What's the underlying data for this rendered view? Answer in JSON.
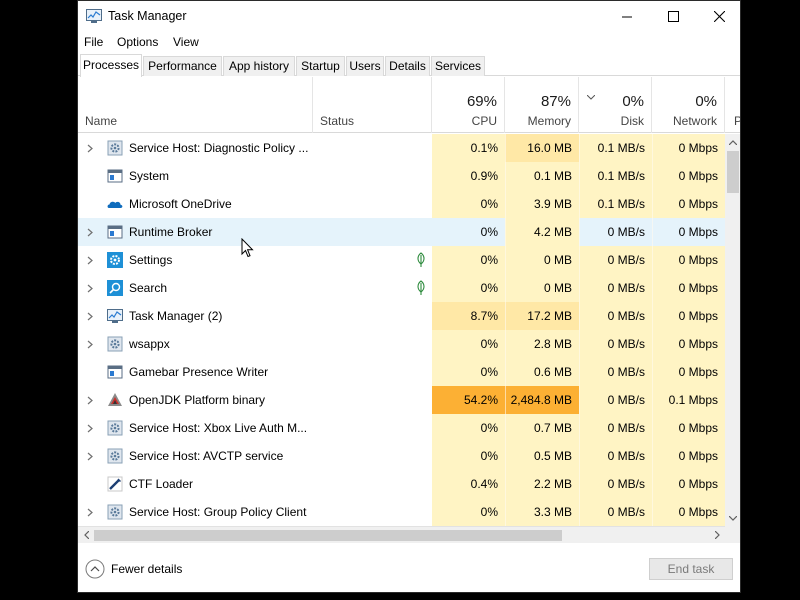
{
  "window": {
    "title": "Task Manager"
  },
  "menu": [
    "File",
    "Options",
    "View"
  ],
  "tabs": [
    "Processes",
    "Performance",
    "App history",
    "Startup",
    "Users",
    "Details",
    "Services"
  ],
  "active_tab": "Processes",
  "columns": {
    "name": "Name",
    "status": "Status",
    "cpu": {
      "pct": "69%",
      "label": "CPU"
    },
    "memory": {
      "pct": "87%",
      "label": "Memory"
    },
    "disk": {
      "pct": "0%",
      "label": "Disk"
    },
    "network": {
      "pct": "0%",
      "label": "Network"
    },
    "power": {
      "label": "P"
    }
  },
  "processes": [
    {
      "name": "Service Host: Diagnostic Policy ...",
      "icon": "gear-icon",
      "expandable": true,
      "status": "",
      "cpu": "0.1%",
      "memory": "16.0 MB",
      "disk": "0.1 MB/s",
      "network": "0 Mbps"
    },
    {
      "name": "System",
      "icon": "window-icon",
      "expandable": false,
      "status": "",
      "cpu": "0.9%",
      "memory": "0.1 MB",
      "disk": "0.1 MB/s",
      "network": "0 Mbps"
    },
    {
      "name": "Microsoft OneDrive",
      "icon": "cloud-icon",
      "expandable": false,
      "status": "",
      "cpu": "0%",
      "memory": "3.9 MB",
      "disk": "0.1 MB/s",
      "network": "0 Mbps"
    },
    {
      "name": "Runtime Broker",
      "icon": "window-icon",
      "expandable": true,
      "status": "",
      "cpu": "0%",
      "memory": "4.2 MB",
      "disk": "0 MB/s",
      "network": "0 Mbps"
    },
    {
      "name": "Settings",
      "icon": "settings-gear-icon",
      "expandable": true,
      "status": "suspended-leaf-icon",
      "cpu": "0%",
      "memory": "0 MB",
      "disk": "0 MB/s",
      "network": "0 Mbps"
    },
    {
      "name": "Search",
      "icon": "search-icon",
      "expandable": true,
      "status": "suspended-leaf-icon",
      "cpu": "0%",
      "memory": "0 MB",
      "disk": "0 MB/s",
      "network": "0 Mbps"
    },
    {
      "name": "Task Manager (2)",
      "icon": "task-manager-icon",
      "expandable": true,
      "status": "",
      "cpu": "8.7%",
      "memory": "17.2 MB",
      "disk": "0 MB/s",
      "network": "0 Mbps"
    },
    {
      "name": "wsappx",
      "icon": "gear-icon",
      "expandable": true,
      "status": "",
      "cpu": "0%",
      "memory": "2.8 MB",
      "disk": "0 MB/s",
      "network": "0 Mbps"
    },
    {
      "name": "Gamebar Presence Writer",
      "icon": "window-icon",
      "expandable": false,
      "status": "",
      "cpu": "0%",
      "memory": "0.6 MB",
      "disk": "0 MB/s",
      "network": "0 Mbps"
    },
    {
      "name": "OpenJDK Platform binary",
      "icon": "java-icon",
      "expandable": true,
      "status": "",
      "cpu": "54.2%",
      "memory": "2,484.8 MB",
      "disk": "0 MB/s",
      "network": "0.1 Mbps"
    },
    {
      "name": "Service Host: Xbox Live Auth M...",
      "icon": "gear-icon",
      "expandable": true,
      "status": "",
      "cpu": "0%",
      "memory": "0.7 MB",
      "disk": "0 MB/s",
      "network": "0 Mbps"
    },
    {
      "name": "Service Host: AVCTP service",
      "icon": "gear-icon",
      "expandable": true,
      "status": "",
      "cpu": "0%",
      "memory": "0.5 MB",
      "disk": "0 MB/s",
      "network": "0 Mbps"
    },
    {
      "name": "CTF Loader",
      "icon": "pen-icon",
      "expandable": false,
      "status": "",
      "cpu": "0.4%",
      "memory": "2.2 MB",
      "disk": "0 MB/s",
      "network": "0 Mbps"
    },
    {
      "name": "Service Host: Group Policy Client",
      "icon": "gear-icon",
      "expandable": true,
      "status": "",
      "cpu": "0%",
      "memory": "3.3 MB",
      "disk": "0 MB/s",
      "network": "0 Mbps"
    }
  ],
  "hovered_row": 3,
  "colors": {
    "heat_low": "#fff4c4",
    "heat_mid": "#ffe8a6",
    "heat_high": "#ffd27a",
    "heat_max": "#fcb034",
    "hover": "#e5f3fb",
    "accent_blue": "#0078d7"
  },
  "footer": {
    "fewer_details": "Fewer details",
    "end_task": "End task"
  }
}
